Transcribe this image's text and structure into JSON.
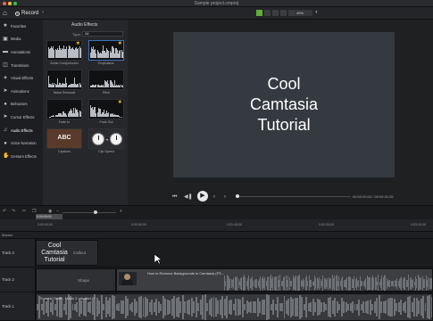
{
  "window": {
    "title": "Sample project.cmproj",
    "dots": [
      "#fe5f57",
      "#febc2e",
      "#28c840"
    ]
  },
  "toolbar": {
    "record_label": "Record",
    "zoom_value": "49%"
  },
  "sidebar": {
    "items": [
      {
        "label": "Favorites",
        "icon": "star-icon"
      },
      {
        "label": "Media",
        "icon": "media-icon"
      },
      {
        "label": "Annotations",
        "icon": "annotation-icon"
      },
      {
        "label": "Transitions",
        "icon": "transition-icon"
      },
      {
        "label": "Visual Effects",
        "icon": "wand-icon"
      },
      {
        "label": "Animations",
        "icon": "animation-icon"
      },
      {
        "label": "Behaviors",
        "icon": "behavior-icon"
      },
      {
        "label": "Cursor Effects",
        "icon": "cursor-icon"
      },
      {
        "label": "Audio Effects",
        "icon": "audio-icon"
      },
      {
        "label": "Voice Narration",
        "icon": "mic-icon"
      },
      {
        "label": "Gesture Effects",
        "icon": "gesture-icon"
      }
    ]
  },
  "panel": {
    "title": "Audio Effects",
    "type_label": "Type:",
    "type_value": "All",
    "effects": [
      {
        "label": "Audio Compression",
        "star": true
      },
      {
        "label": "Emphasize",
        "star": true
      },
      {
        "label": "Noise Removal",
        "star": false
      },
      {
        "label": "Pitch",
        "star": false
      },
      {
        "label": "Fade In",
        "star": false
      },
      {
        "label": "Fade Out",
        "star": true
      },
      {
        "label": "Captions",
        "star": false
      },
      {
        "label": "Clip Speed",
        "star": false
      }
    ],
    "captions_thumb_text": "ABC"
  },
  "canvas": {
    "lines": [
      "Cool",
      "Camtasia",
      "Tutorial"
    ],
    "background": "#343a3f"
  },
  "playback": {
    "timecode": "00:00:00;00 / 00:05:31;05"
  },
  "timeline": {
    "playhead_time": "0:00:00;00",
    "ticks": [
      "0:00:00;00",
      "0:00:50;00",
      "0:01:40;00",
      "0:02:30;00",
      "0:03:20;00",
      "0:04:10;00",
      "0:05:00;00"
    ],
    "marker_label": "Marker",
    "tracks": [
      {
        "name": "Track 3",
        "clip_title": "Cool Camtasia Tutorial",
        "clip_type": "Callout"
      },
      {
        "name": "Track 2",
        "clip_type": "Shape",
        "video_title": "How to Remove Backgrounds in Camtasia (FS..."
      },
      {
        "name": "Track 1",
        "audio_title": "Summit Taste - Music 2 - Audio1.B"
      }
    ]
  }
}
